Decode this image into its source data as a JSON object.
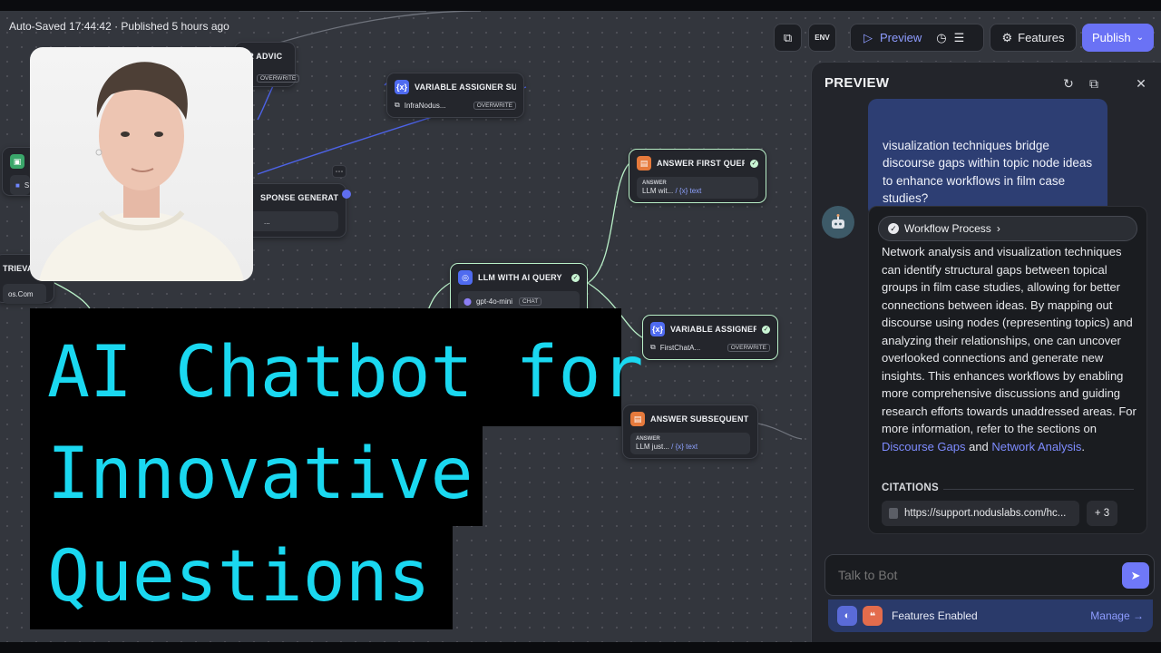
{
  "status": {
    "autosave": "Auto-Saved 17:44:42 · Published 5 hours ago"
  },
  "toolbar": {
    "env_label": "ENV",
    "preview_label": "Preview",
    "features_label": "Features",
    "publish_label": "Publish"
  },
  "nodes": [
    {
      "id": "llm-advice",
      "title": "ER ADVIC",
      "tag": "OVERWRITE"
    },
    {
      "id": "var-summ",
      "title": "VARIABLE ASSIGNER SUMM",
      "row": "InfraNodus...",
      "tag": "OVERWRITE"
    },
    {
      "id": "response",
      "title": "SPONSE GENERATED",
      "row": "..."
    },
    {
      "id": "left-k",
      "title": "K",
      "row": "S"
    },
    {
      "id": "retrieval",
      "title": "TRIEVAL",
      "row": "os.Com"
    },
    {
      "id": "answer-first",
      "title": "ANSWER FIRST QUERY",
      "label": "ANSWER",
      "row_a": "LLM wit...",
      "row_b": "/ {x} text"
    },
    {
      "id": "llm-ai",
      "title": "LLM WITH AI QUERY",
      "row": "gpt-4o-mini",
      "tag": "CHAT"
    },
    {
      "id": "var-first",
      "title": "VARIABLE ASSIGNER FIRS'",
      "row": "FirstChatA...",
      "tag": "OVERWRITE"
    },
    {
      "id": "answer-sub",
      "title": "ANSWER SUBSEQUENT QUE",
      "label": "ANSWER",
      "row_a": "LLM just...",
      "row_b": "/ {x} text"
    }
  ],
  "headline": {
    "line1": "AI Chatbot for",
    "line2": "Innovative",
    "line3": "Questions"
  },
  "preview": {
    "title": "PREVIEW",
    "user_message": "visualization techniques bridge discourse gaps within topic node ideas to enhance workflows in film case studies?",
    "workflow_label": "Workflow Process",
    "answer_text": "Network analysis and visualization techniques can identify structural gaps between topical groups in film case studies, allowing for better connections between ideas. By mapping out discourse using nodes (representing topics) and analyzing their relationships, one can uncover overlooked connections and generate new insights. This enhances workflows by enabling more comprehensive discussions and guiding research efforts towards unaddressed areas. For more information, refer to the sections on ",
    "link1": "Discourse Gaps",
    "and_text": " and ",
    "link2": "Network Analysis",
    "end_text": ".",
    "citations_label": "CITATIONS",
    "citation_url": "https://support.noduslabs.com/hc...",
    "citation_more": "+ 3",
    "input_placeholder": "Talk to Bot",
    "features_enabled": "Features Enabled",
    "manage_label": "Manage"
  },
  "icons": [
    "window-icon",
    "env-icon",
    "play-icon",
    "history-icon",
    "checklist-icon",
    "features-icon",
    "chevron-down-icon",
    "refresh-icon",
    "open-external-icon",
    "close-icon",
    "robot-icon",
    "check-icon",
    "chevron-right-icon",
    "file-icon",
    "send-icon",
    "arrow-right-icon"
  ],
  "colors": {
    "accent": "#6a72f5",
    "headline": "#1ad8f0",
    "link": "#7e8cff",
    "user_bubble": "#2d3e73"
  }
}
